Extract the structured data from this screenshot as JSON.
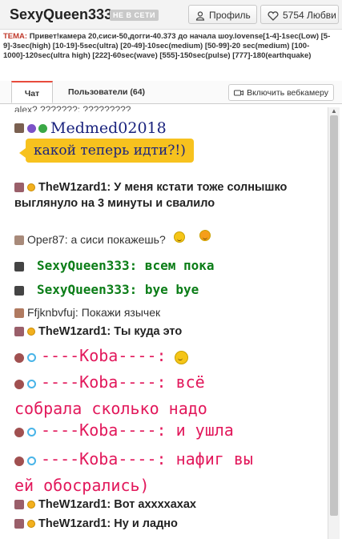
{
  "header": {
    "username": "SexyQueen333",
    "offline_badge": "НЕ В СЕТИ",
    "profile_label": "Профиль",
    "love_label": "5754 Любви"
  },
  "topic": {
    "label": "ТЕМА:",
    "text": "Привет!камера 20,сиси-50,догги-40.373 до начала шоу.lovense[1-4]-1sec(Low) [5-9]-3sec(high) [10-19]-5sec(ultra) [20-49]-10sec(medium) [50-99]-20 sec(medium) [100-1000]-120sec(ultra high) [222]-60sec(wave) [555]-150sec(pulse) [777]-180(earthquake)"
  },
  "tabs": {
    "chat": "Чат",
    "users": "Пользователи (64)",
    "webcam": "Включить вебкамеру"
  },
  "messages": {
    "m0": "alex? ???????: ?????????",
    "m1_user": "Medmed02018",
    "m1_text": "какой теперь идти?!)",
    "m2_user": "TheW1zard1:",
    "m2_text": "У меня кстати тоже солнышко выглянуло на 3 минуты и свалило",
    "m3_user": "Oper87:",
    "m3_text": "а сиси покажешь?",
    "m4": "SexyQueen333: всем пока",
    "m5": "SexyQueen333: bye bye",
    "m6_user": "Ffjknbvfuj:",
    "m6_text": "Покажи язычек",
    "m7_user": "TheW1zard1:",
    "m7_text": "Ты куда это",
    "m8": "----Koba----:",
    "m9_a": "----Koba----: всё",
    "m9_b": "собрала сколько надо",
    "m10": "----Koba----: и ушла",
    "m11_a": "----Koba----: нафиг вы",
    "m11_b": "ей обосрались)",
    "m12_user": "TheW1zard1:",
    "m12_text": "Вот аххххахах",
    "m13_user": "TheW1zard1:",
    "m13_text": "Ну и ладно"
  }
}
